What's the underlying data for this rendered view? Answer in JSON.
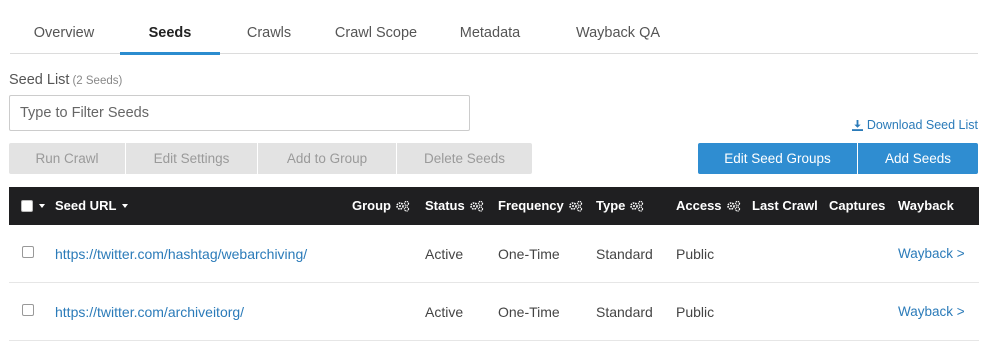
{
  "tabs": [
    {
      "label": "Overview"
    },
    {
      "label": "Seeds",
      "active": true
    },
    {
      "label": "Crawls"
    },
    {
      "label": "Crawl Scope"
    },
    {
      "label": "Metadata"
    },
    {
      "label": "Wayback QA"
    }
  ],
  "seed_list": {
    "title": "Seed List",
    "count": "(2 Seeds)",
    "filter_placeholder": "Type to Filter Seeds",
    "filter_value": "",
    "download_label": "Download Seed List"
  },
  "actions": {
    "run_crawl": "Run Crawl",
    "edit_settings": "Edit Settings",
    "add_to_group": "Add to Group",
    "delete_seeds": "Delete Seeds",
    "edit_seed_groups": "Edit Seed Groups",
    "add_seeds": "Add Seeds"
  },
  "table": {
    "headers": {
      "seed_url": "Seed URL",
      "group": "Group",
      "status": "Status",
      "frequency": "Frequency",
      "type": "Type",
      "access": "Access",
      "last_crawl": "Last Crawl",
      "captures": "Captures",
      "wayback": "Wayback"
    },
    "rows": [
      {
        "url": "https://twitter.com/hashtag/webarchiving/",
        "group": "",
        "status": "Active",
        "frequency": "One-Time",
        "type": "Standard",
        "access": "Public",
        "last_crawl": "",
        "captures": "",
        "wayback": "Wayback >"
      },
      {
        "url": "https://twitter.com/archiveitorg/",
        "group": "",
        "status": "Active",
        "frequency": "One-Time",
        "type": "Standard",
        "access": "Public",
        "last_crawl": "",
        "captures": "",
        "wayback": "Wayback >"
      }
    ]
  },
  "colors": {
    "accent": "#2f8dd1",
    "link": "#2b7bb9",
    "table_header_bg": "#1f1f21",
    "disabled_bg": "#e3e3e3"
  }
}
